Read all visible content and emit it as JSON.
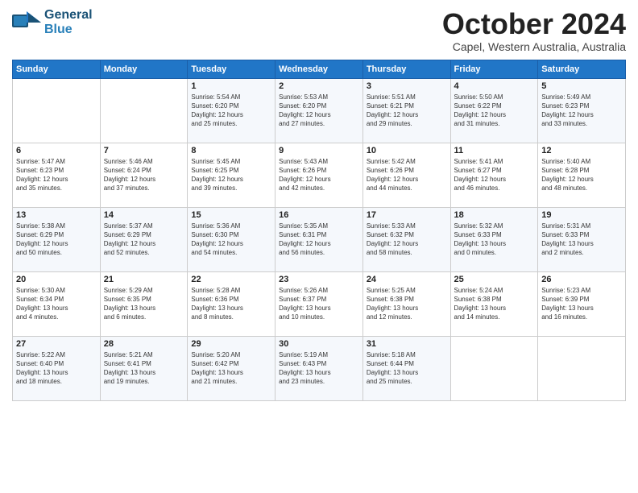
{
  "logo": {
    "line1": "General",
    "line2": "Blue"
  },
  "title": "October 2024",
  "subtitle": "Capel, Western Australia, Australia",
  "days_of_week": [
    "Sunday",
    "Monday",
    "Tuesday",
    "Wednesday",
    "Thursday",
    "Friday",
    "Saturday"
  ],
  "weeks": [
    [
      {
        "day": "",
        "info": ""
      },
      {
        "day": "",
        "info": ""
      },
      {
        "day": "1",
        "info": "Sunrise: 5:54 AM\nSunset: 6:20 PM\nDaylight: 12 hours\nand 25 minutes."
      },
      {
        "day": "2",
        "info": "Sunrise: 5:53 AM\nSunset: 6:20 PM\nDaylight: 12 hours\nand 27 minutes."
      },
      {
        "day": "3",
        "info": "Sunrise: 5:51 AM\nSunset: 6:21 PM\nDaylight: 12 hours\nand 29 minutes."
      },
      {
        "day": "4",
        "info": "Sunrise: 5:50 AM\nSunset: 6:22 PM\nDaylight: 12 hours\nand 31 minutes."
      },
      {
        "day": "5",
        "info": "Sunrise: 5:49 AM\nSunset: 6:23 PM\nDaylight: 12 hours\nand 33 minutes."
      }
    ],
    [
      {
        "day": "6",
        "info": "Sunrise: 5:47 AM\nSunset: 6:23 PM\nDaylight: 12 hours\nand 35 minutes."
      },
      {
        "day": "7",
        "info": "Sunrise: 5:46 AM\nSunset: 6:24 PM\nDaylight: 12 hours\nand 37 minutes."
      },
      {
        "day": "8",
        "info": "Sunrise: 5:45 AM\nSunset: 6:25 PM\nDaylight: 12 hours\nand 39 minutes."
      },
      {
        "day": "9",
        "info": "Sunrise: 5:43 AM\nSunset: 6:26 PM\nDaylight: 12 hours\nand 42 minutes."
      },
      {
        "day": "10",
        "info": "Sunrise: 5:42 AM\nSunset: 6:26 PM\nDaylight: 12 hours\nand 44 minutes."
      },
      {
        "day": "11",
        "info": "Sunrise: 5:41 AM\nSunset: 6:27 PM\nDaylight: 12 hours\nand 46 minutes."
      },
      {
        "day": "12",
        "info": "Sunrise: 5:40 AM\nSunset: 6:28 PM\nDaylight: 12 hours\nand 48 minutes."
      }
    ],
    [
      {
        "day": "13",
        "info": "Sunrise: 5:38 AM\nSunset: 6:29 PM\nDaylight: 12 hours\nand 50 minutes."
      },
      {
        "day": "14",
        "info": "Sunrise: 5:37 AM\nSunset: 6:29 PM\nDaylight: 12 hours\nand 52 minutes."
      },
      {
        "day": "15",
        "info": "Sunrise: 5:36 AM\nSunset: 6:30 PM\nDaylight: 12 hours\nand 54 minutes."
      },
      {
        "day": "16",
        "info": "Sunrise: 5:35 AM\nSunset: 6:31 PM\nDaylight: 12 hours\nand 56 minutes."
      },
      {
        "day": "17",
        "info": "Sunrise: 5:33 AM\nSunset: 6:32 PM\nDaylight: 12 hours\nand 58 minutes."
      },
      {
        "day": "18",
        "info": "Sunrise: 5:32 AM\nSunset: 6:33 PM\nDaylight: 13 hours\nand 0 minutes."
      },
      {
        "day": "19",
        "info": "Sunrise: 5:31 AM\nSunset: 6:33 PM\nDaylight: 13 hours\nand 2 minutes."
      }
    ],
    [
      {
        "day": "20",
        "info": "Sunrise: 5:30 AM\nSunset: 6:34 PM\nDaylight: 13 hours\nand 4 minutes."
      },
      {
        "day": "21",
        "info": "Sunrise: 5:29 AM\nSunset: 6:35 PM\nDaylight: 13 hours\nand 6 minutes."
      },
      {
        "day": "22",
        "info": "Sunrise: 5:28 AM\nSunset: 6:36 PM\nDaylight: 13 hours\nand 8 minutes."
      },
      {
        "day": "23",
        "info": "Sunrise: 5:26 AM\nSunset: 6:37 PM\nDaylight: 13 hours\nand 10 minutes."
      },
      {
        "day": "24",
        "info": "Sunrise: 5:25 AM\nSunset: 6:38 PM\nDaylight: 13 hours\nand 12 minutes."
      },
      {
        "day": "25",
        "info": "Sunrise: 5:24 AM\nSunset: 6:38 PM\nDaylight: 13 hours\nand 14 minutes."
      },
      {
        "day": "26",
        "info": "Sunrise: 5:23 AM\nSunset: 6:39 PM\nDaylight: 13 hours\nand 16 minutes."
      }
    ],
    [
      {
        "day": "27",
        "info": "Sunrise: 5:22 AM\nSunset: 6:40 PM\nDaylight: 13 hours\nand 18 minutes."
      },
      {
        "day": "28",
        "info": "Sunrise: 5:21 AM\nSunset: 6:41 PM\nDaylight: 13 hours\nand 19 minutes."
      },
      {
        "day": "29",
        "info": "Sunrise: 5:20 AM\nSunset: 6:42 PM\nDaylight: 13 hours\nand 21 minutes."
      },
      {
        "day": "30",
        "info": "Sunrise: 5:19 AM\nSunset: 6:43 PM\nDaylight: 13 hours\nand 23 minutes."
      },
      {
        "day": "31",
        "info": "Sunrise: 5:18 AM\nSunset: 6:44 PM\nDaylight: 13 hours\nand 25 minutes."
      },
      {
        "day": "",
        "info": ""
      },
      {
        "day": "",
        "info": ""
      }
    ]
  ]
}
